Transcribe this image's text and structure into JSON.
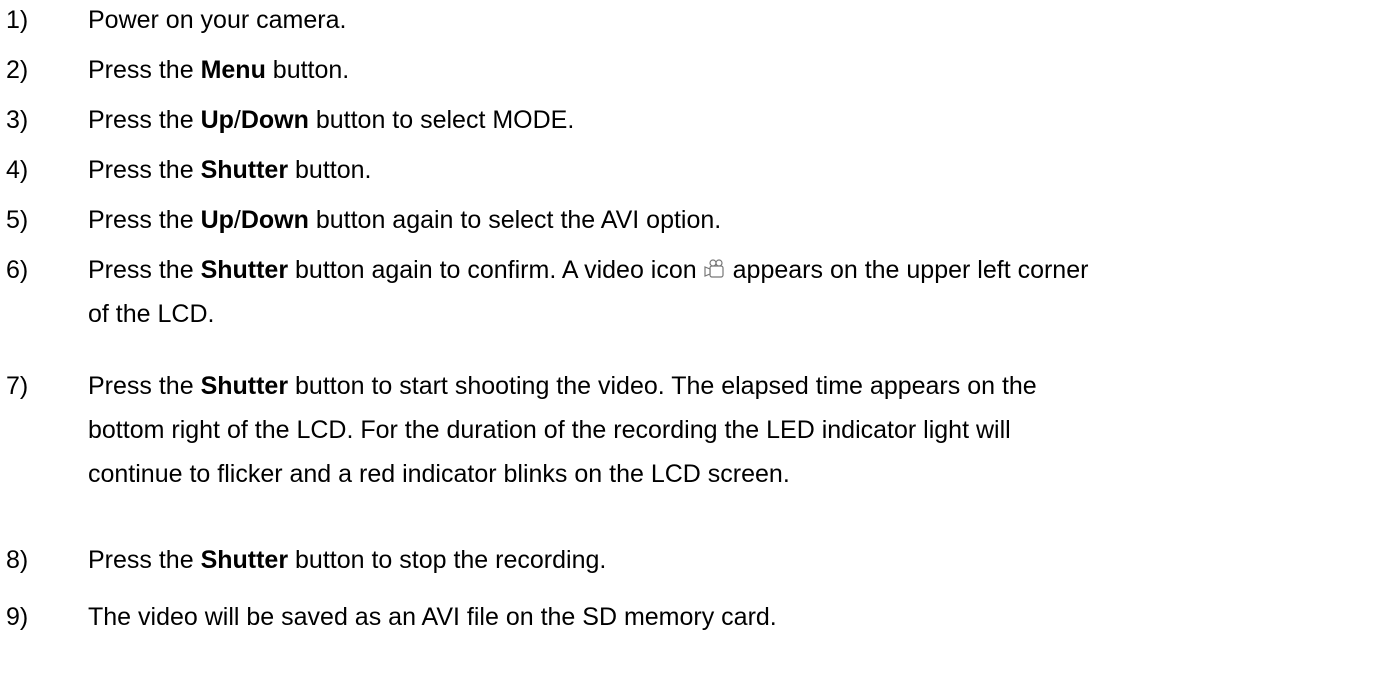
{
  "steps": [
    {
      "number": "1)",
      "parts": {
        "a": "Power on your camera."
      }
    },
    {
      "number": "2)",
      "parts": {
        "a": "Press the ",
        "b1": "Menu",
        "c": " button."
      }
    },
    {
      "number": "3)",
      "parts": {
        "a": "Press the ",
        "b1": "Up",
        "sep": "/",
        "b2": "Down",
        "c": " button to select MODE."
      }
    },
    {
      "number": "4)",
      "parts": {
        "a": "Press the ",
        "b1": "Shutter",
        "c": " button."
      }
    },
    {
      "number": "5)",
      "parts": {
        "a": "Press the ",
        "b1": "Up",
        "sep": "/",
        "b2": "Down",
        "c": " button again to select the AVI option."
      }
    },
    {
      "number": "6)",
      "parts": {
        "a": "Press the ",
        "b1": "Shutter",
        "c": " button again to confirm. A video icon",
        "d": "appears on the upper left corner",
        "e": "of the LCD."
      },
      "icon": "video-camera-icon"
    },
    {
      "number": "7)",
      "parts": {
        "a": "Press the ",
        "b1": "Shutter",
        "c": " button to start shooting the video. The elapsed time appears on the",
        "d": "bottom right of the LCD. For the duration of the recording the LED indicator light will",
        "e": "continue to flicker and a red indicator blinks on the LCD screen."
      }
    },
    {
      "number": "8)",
      "parts": {
        "a": "Press the ",
        "b1": "Shutter",
        "c": " button to stop the recording."
      }
    },
    {
      "number": "9)",
      "parts": {
        "a": "The video will be saved as an AVI file on the SD memory card."
      }
    }
  ]
}
